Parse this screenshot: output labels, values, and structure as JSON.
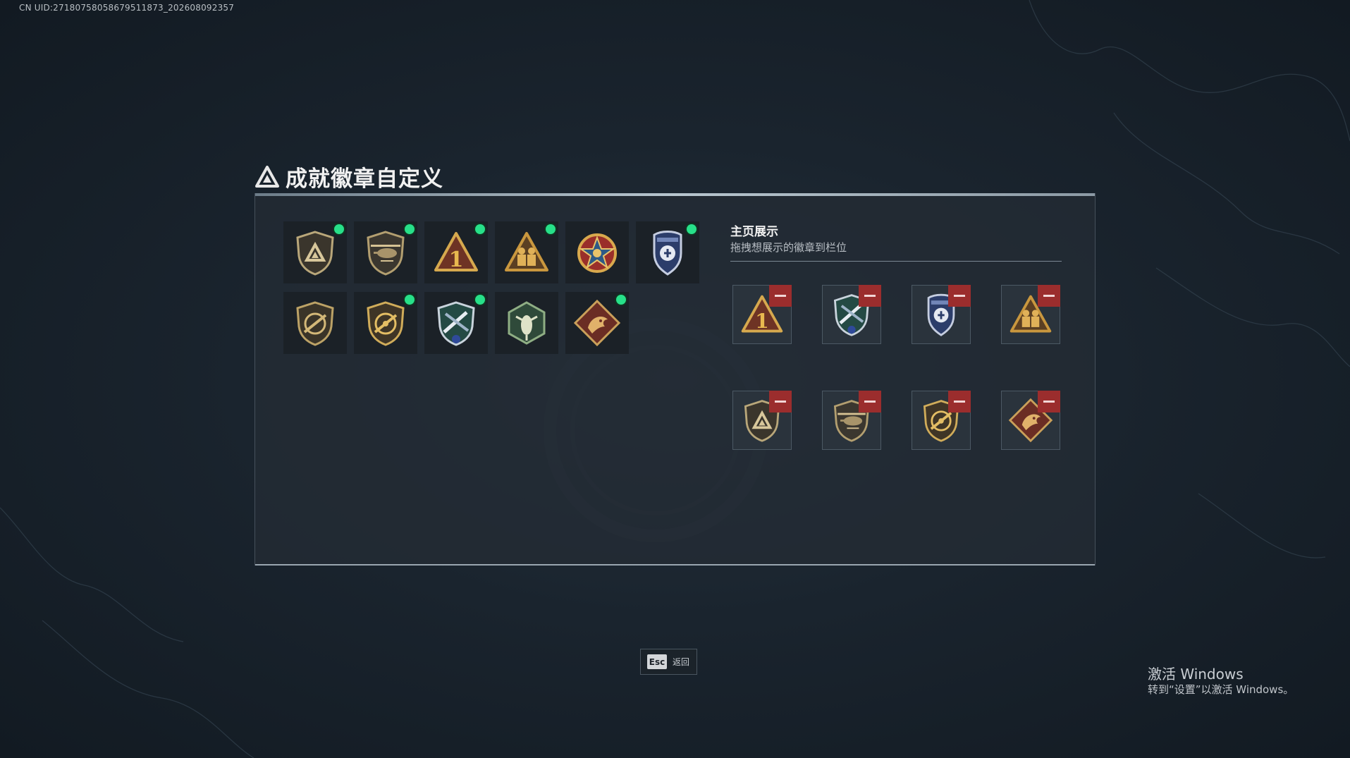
{
  "uid_text": "CN UID:271807580586795118​73_202608092357",
  "title": "成就徽章自定义",
  "side": {
    "title": "主页展示",
    "subtitle": "拖拽想展示的徽章到栏位"
  },
  "collection": [
    {
      "icon": "shield-triangle-badge-icon",
      "new": true
    },
    {
      "icon": "helicopter-badge-icon",
      "new": true
    },
    {
      "icon": "number-one-badge-icon",
      "new": true
    },
    {
      "icon": "soldiers-triangle-badge-icon",
      "new": true
    },
    {
      "icon": "star-medal-badge-icon",
      "new": false
    },
    {
      "icon": "police-shield-badge-icon",
      "new": true
    },
    {
      "icon": "rifle-shield-badge-icon",
      "new": false
    },
    {
      "icon": "rifle-shield-gold-badge-icon",
      "new": true
    },
    {
      "icon": "rockets-shield-badge-icon",
      "new": true
    },
    {
      "icon": "hornet-hexagon-badge-icon",
      "new": false
    },
    {
      "icon": "dragon-diamond-badge-icon",
      "new": true
    }
  ],
  "showcase": [
    {
      "icon": "number-one-badge-icon"
    },
    {
      "icon": "rockets-shield-badge-icon"
    },
    {
      "icon": "police-shield-badge-icon"
    },
    {
      "icon": "soldiers-triangle-badge-icon"
    },
    {
      "icon": "shield-triangle-badge-icon"
    },
    {
      "icon": "helicopter-badge-icon"
    },
    {
      "icon": "rifle-shield-gold-badge-icon"
    },
    {
      "icon": "dragon-diamond-badge-icon"
    }
  ],
  "esc": {
    "key": "Esc",
    "label": "返回"
  },
  "windows": {
    "title": "激活 Windows",
    "subtitle": "转到“设置”以激活 Windows。"
  },
  "colors": {
    "new_dot": "#27e089",
    "remove": "#9b2d2d",
    "accent": "#b8c6cf"
  }
}
